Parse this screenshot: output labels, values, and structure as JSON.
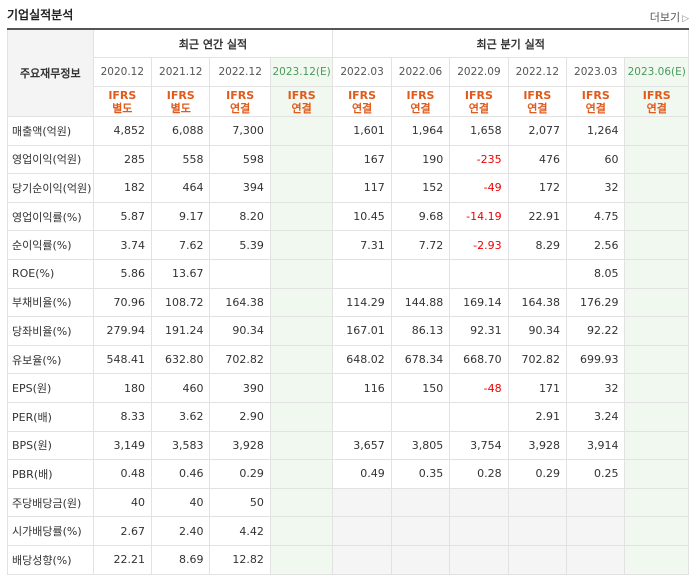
{
  "header": {
    "title": "기업실적분석",
    "more": "더보기",
    "more_icon": "chevron-right"
  },
  "table": {
    "corner_label": "주요재무정보",
    "groups": [
      "최근 연간 실적",
      "최근 분기 실적"
    ],
    "periods": [
      "2020.12",
      "2021.12",
      "2022.12",
      "2023.12(E)",
      "2022.03",
      "2022.06",
      "2022.09",
      "2022.12",
      "2023.03",
      "2023.06(E)"
    ],
    "standards": [
      [
        "IFRS",
        "별도"
      ],
      [
        "IFRS",
        "별도"
      ],
      [
        "IFRS",
        "연결"
      ],
      [
        "IFRS",
        "연결"
      ],
      [
        "IFRS",
        "연결"
      ],
      [
        "IFRS",
        "연결"
      ],
      [
        "IFRS",
        "연결"
      ],
      [
        "IFRS",
        "연결"
      ],
      [
        "IFRS",
        "연결"
      ],
      [
        "IFRS",
        "연결"
      ]
    ],
    "rows": [
      {
        "label": "매출액(억원)",
        "values": [
          "4,852",
          "6,088",
          "7,300",
          "",
          "1,601",
          "1,964",
          "1,658",
          "2,077",
          "1,264",
          ""
        ]
      },
      {
        "label": "영업이익(억원)",
        "values": [
          "285",
          "558",
          "598",
          "",
          "167",
          "190",
          "-235",
          "476",
          "60",
          ""
        ]
      },
      {
        "label": "당기순이익(억원)",
        "values": [
          "182",
          "464",
          "394",
          "",
          "117",
          "152",
          "-49",
          "172",
          "32",
          ""
        ]
      },
      {
        "label": "영업이익률(%)",
        "values": [
          "5.87",
          "9.17",
          "8.20",
          "",
          "10.45",
          "9.68",
          "-14.19",
          "22.91",
          "4.75",
          ""
        ]
      },
      {
        "label": "순이익률(%)",
        "values": [
          "3.74",
          "7.62",
          "5.39",
          "",
          "7.31",
          "7.72",
          "-2.93",
          "8.29",
          "2.56",
          ""
        ]
      },
      {
        "label": "ROE(%)",
        "values": [
          "5.86",
          "13.67",
          "",
          "",
          "",
          "",
          "",
          "",
          "8.05",
          ""
        ]
      },
      {
        "label": "부채비율(%)",
        "values": [
          "70.96",
          "108.72",
          "164.38",
          "",
          "114.29",
          "144.88",
          "169.14",
          "164.38",
          "176.29",
          ""
        ]
      },
      {
        "label": "당좌비율(%)",
        "values": [
          "279.94",
          "191.24",
          "90.34",
          "",
          "167.01",
          "86.13",
          "92.31",
          "90.34",
          "92.22",
          ""
        ]
      },
      {
        "label": "유보율(%)",
        "values": [
          "548.41",
          "632.80",
          "702.82",
          "",
          "648.02",
          "678.34",
          "668.70",
          "702.82",
          "699.93",
          ""
        ]
      },
      {
        "label": "EPS(원)",
        "values": [
          "180",
          "460",
          "390",
          "",
          "116",
          "150",
          "-48",
          "171",
          "32",
          ""
        ]
      },
      {
        "label": "PER(배)",
        "values": [
          "8.33",
          "3.62",
          "2.90",
          "",
          "",
          "",
          "",
          "2.91",
          "3.24",
          ""
        ]
      },
      {
        "label": "BPS(원)",
        "values": [
          "3,149",
          "3,583",
          "3,928",
          "",
          "3,657",
          "3,805",
          "3,754",
          "3,928",
          "3,914",
          ""
        ]
      },
      {
        "label": "PBR(배)",
        "values": [
          "0.48",
          "0.46",
          "0.29",
          "",
          "0.49",
          "0.35",
          "0.28",
          "0.29",
          "0.25",
          ""
        ]
      },
      {
        "label": "주당배당금(원)",
        "values": [
          "40",
          "40",
          "50",
          "",
          "",
          "",
          "",
          "",
          "",
          ""
        ]
      },
      {
        "label": "시가배당률(%)",
        "values": [
          "2.67",
          "2.40",
          "4.42",
          "",
          "",
          "",
          "",
          "",
          "",
          ""
        ]
      },
      {
        "label": "배당성향(%)",
        "values": [
          "22.21",
          "8.69",
          "12.82",
          "",
          "",
          "",
          "",
          "",
          "",
          ""
        ]
      }
    ]
  }
}
